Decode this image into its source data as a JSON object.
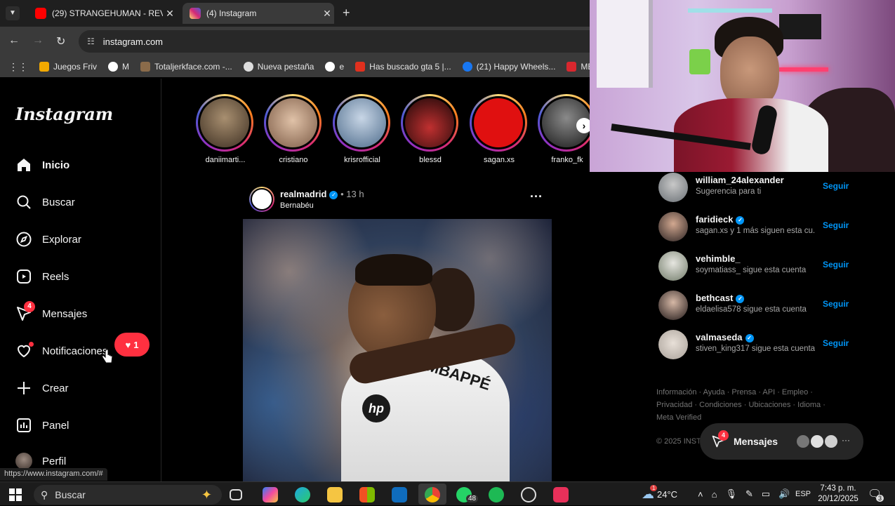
{
  "browser": {
    "tabs": [
      {
        "title": "(29) STRANGEHUMAN - REVEN",
        "active": false,
        "icon": "youtube-icon"
      },
      {
        "title": "(4) Instagram",
        "active": true,
        "icon": "instagram-icon"
      }
    ],
    "url": "instagram.com",
    "bookmarks": [
      {
        "label": "Juegos Friv",
        "color": "#f2a900"
      },
      {
        "label": "M",
        "color": "#4285f4"
      },
      {
        "label": "Totaljerkface.com -...",
        "color": "#8a6b4a"
      },
      {
        "label": "Nueva pestaña",
        "color": "#dddddd"
      },
      {
        "label": "e",
        "color": "#ea4335"
      },
      {
        "label": "Has buscado gta 5 |...",
        "color": "#e0301e"
      },
      {
        "label": "(21) Happy Wheels...",
        "color": "#1877f2"
      },
      {
        "label": "MEGA 8",
        "color": "#d9272e"
      }
    ]
  },
  "instagram": {
    "logo": "Instagram",
    "nav": [
      {
        "label": "Inicio",
        "icon": "home-icon"
      },
      {
        "label": "Buscar",
        "icon": "search-icon"
      },
      {
        "label": "Explorar",
        "icon": "compass-icon"
      },
      {
        "label": "Reels",
        "icon": "reels-icon"
      },
      {
        "label": "Mensajes",
        "icon": "messenger-icon",
        "badge": "4"
      },
      {
        "label": "Notificaciones",
        "icon": "heart-icon"
      },
      {
        "label": "Crear",
        "icon": "plus-icon"
      },
      {
        "label": "Panel",
        "icon": "chart-icon"
      },
      {
        "label": "Perfil",
        "icon": "avatar"
      }
    ],
    "notif_pill": "1",
    "stories": [
      {
        "name": "daniimarti...",
        "color": "#6b5a48"
      },
      {
        "name": "cristiano",
        "color": "#b08b6e"
      },
      {
        "name": "krisrofficial",
        "color": "#8fa6c2"
      },
      {
        "name": "blessd",
        "color": "#5a1d1d"
      },
      {
        "name": "sagan.xs",
        "color": "#e01010"
      },
      {
        "name": "franko_fk",
        "color": "#3a3a3a"
      }
    ],
    "post": {
      "username": "realmadrid",
      "time": "13 h",
      "location": "Bernabéu",
      "jersey": "MBAPPÉ"
    },
    "suggestions": [
      {
        "user": "william_24alexander",
        "sub": "Sugerencia para ti",
        "verified": false,
        "follow": "Seguir",
        "color": "#9aa3a8"
      },
      {
        "user": "faridieck",
        "sub": "sagan.xs y 1 más siguen esta cu...",
        "verified": true,
        "follow": "Seguir",
        "color": "#4a4040"
      },
      {
        "user": "vehimble_",
        "sub": "soymatiass_ sigue esta cuenta",
        "verified": false,
        "follow": "Seguir",
        "color": "#7a8070"
      },
      {
        "user": "bethcast",
        "sub": "eldaelisa578 sigue esta cuenta",
        "verified": true,
        "follow": "Seguir",
        "color": "#3a3030"
      },
      {
        "user": "valmaseda",
        "sub": "stiven_king317 sigue esta cuenta",
        "verified": true,
        "follow": "Seguir",
        "color": "#c8c0b8"
      }
    ],
    "footer_line1": "Información · Ayuda · Prensa · API · Empleo ·",
    "footer_line2": "Privacidad · Condiciones · Ubicaciones · Idioma ·",
    "footer_line3": "Meta Verified",
    "copyright": "© 2025 INST",
    "messages_pill": {
      "label": "Mensajes",
      "badge": "4"
    }
  },
  "status_url": "https://www.instagram.com/#",
  "taskbar": {
    "search": "Buscar",
    "whatsapp_badge": "48",
    "weather": "24°C",
    "weather_badge": "1",
    "lang": "ESP",
    "time": "7:43 p. m.",
    "date": "20/12/2025",
    "notif_count": "3"
  }
}
